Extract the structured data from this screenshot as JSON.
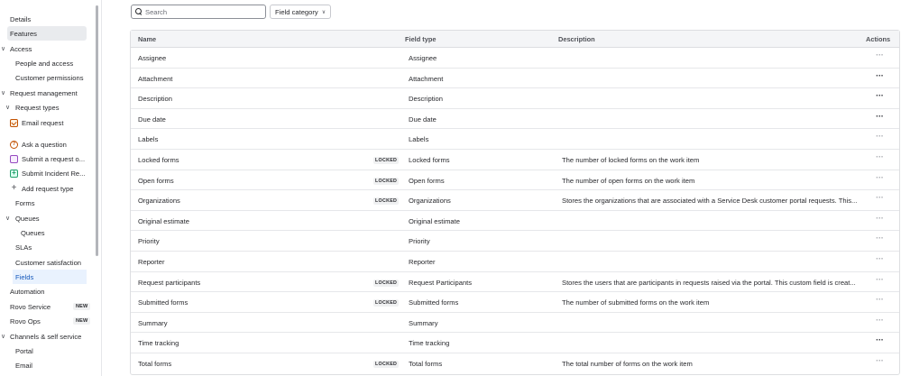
{
  "sidebar": {
    "items": [
      {
        "label": "Details",
        "chevron": "",
        "icon": "",
        "badge": ""
      },
      {
        "label": "Features",
        "chevron": "",
        "icon": "",
        "badge": ""
      },
      {
        "label": "Access",
        "chevron": "∨",
        "icon": "",
        "badge": ""
      },
      {
        "label": "People and access",
        "chevron": "",
        "icon": "",
        "badge": ""
      },
      {
        "label": "Customer permissions",
        "chevron": "",
        "icon": "",
        "badge": ""
      },
      {
        "label": "Request management",
        "chevron": "∨",
        "icon": "",
        "badge": ""
      },
      {
        "label": "Request types",
        "chevron": "∨",
        "icon": "",
        "badge": ""
      },
      {
        "label": "Email request",
        "chevron": "",
        "icon": "email-icon",
        "badge": ""
      },
      {
        "label": "Ask a question",
        "chevron": "",
        "icon": "question-icon",
        "badge": ""
      },
      {
        "label": "Submit a request o...",
        "chevron": "",
        "icon": "form-icon",
        "badge": ""
      },
      {
        "label": "Submit Incident Re...",
        "chevron": "",
        "icon": "incident-icon",
        "badge": ""
      },
      {
        "label": "Add request type",
        "chevron": "",
        "icon": "plus-icon",
        "badge": ""
      },
      {
        "label": "Forms",
        "chevron": "",
        "icon": "",
        "badge": ""
      },
      {
        "label": "Queues",
        "chevron": "∨",
        "icon": "",
        "badge": ""
      },
      {
        "label": "Queues",
        "chevron": "",
        "icon": "",
        "badge": ""
      },
      {
        "label": "SLAs",
        "chevron": "",
        "icon": "",
        "badge": ""
      },
      {
        "label": "Customer satisfaction",
        "chevron": "",
        "icon": "",
        "badge": ""
      },
      {
        "label": "Fields",
        "chevron": "",
        "icon": "",
        "badge": ""
      },
      {
        "label": "Automation",
        "chevron": "",
        "icon": "",
        "badge": ""
      },
      {
        "label": "Rovo Service",
        "chevron": "",
        "icon": "",
        "badge": "NEW"
      },
      {
        "label": "Rovo Ops",
        "chevron": "",
        "icon": "",
        "badge": "NEW"
      },
      {
        "label": "Channels & self service",
        "chevron": "∨",
        "icon": "",
        "badge": ""
      },
      {
        "label": "Portal",
        "chevron": "",
        "icon": "",
        "badge": ""
      },
      {
        "label": "Email",
        "chevron": "",
        "icon": "",
        "badge": ""
      }
    ]
  },
  "toolbar": {
    "search_placeholder": "Search",
    "search_icon": "search-icon",
    "category_label": "Field category",
    "category_icon": "chevron-down-icon"
  },
  "table": {
    "headers": {
      "name": "Name",
      "type": "Field type",
      "description": "Description",
      "actions": "Actions"
    },
    "locked_label": "LOCKED",
    "more_label": "···",
    "rows": [
      {
        "name": "Assignee",
        "locked": false,
        "type": "Assignee",
        "description": ""
      },
      {
        "name": "Attachment",
        "locked": false,
        "type": "Attachment",
        "description": ""
      },
      {
        "name": "Description",
        "locked": false,
        "type": "Description",
        "description": ""
      },
      {
        "name": "Due date",
        "locked": false,
        "type": "Due date",
        "description": ""
      },
      {
        "name": "Labels",
        "locked": false,
        "type": "Labels",
        "description": ""
      },
      {
        "name": "Locked forms",
        "locked": true,
        "type": "Locked forms",
        "description": "The number of locked forms on the work item"
      },
      {
        "name": "Open forms",
        "locked": true,
        "type": "Open forms",
        "description": "The number of open forms on the work item"
      },
      {
        "name": "Organizations",
        "locked": true,
        "type": "Organizations",
        "description": "Stores the organizations that are associated with a Service Desk customer portal requests. This..."
      },
      {
        "name": "Original estimate",
        "locked": false,
        "type": "Original estimate",
        "description": ""
      },
      {
        "name": "Priority",
        "locked": false,
        "type": "Priority",
        "description": ""
      },
      {
        "name": "Reporter",
        "locked": false,
        "type": "Reporter",
        "description": ""
      },
      {
        "name": "Request participants",
        "locked": true,
        "type": "Request Participants",
        "description": "Stores the users that are participants in requests raised via the portal. This custom field is creat..."
      },
      {
        "name": "Submitted forms",
        "locked": true,
        "type": "Submitted forms",
        "description": "The number of submitted forms on the work item"
      },
      {
        "name": "Summary",
        "locked": false,
        "type": "Summary",
        "description": ""
      },
      {
        "name": "Time tracking",
        "locked": false,
        "type": "Time tracking",
        "description": ""
      },
      {
        "name": "Total forms",
        "locked": true,
        "type": "Total forms",
        "description": "The total number of forms on the work item"
      }
    ]
  }
}
